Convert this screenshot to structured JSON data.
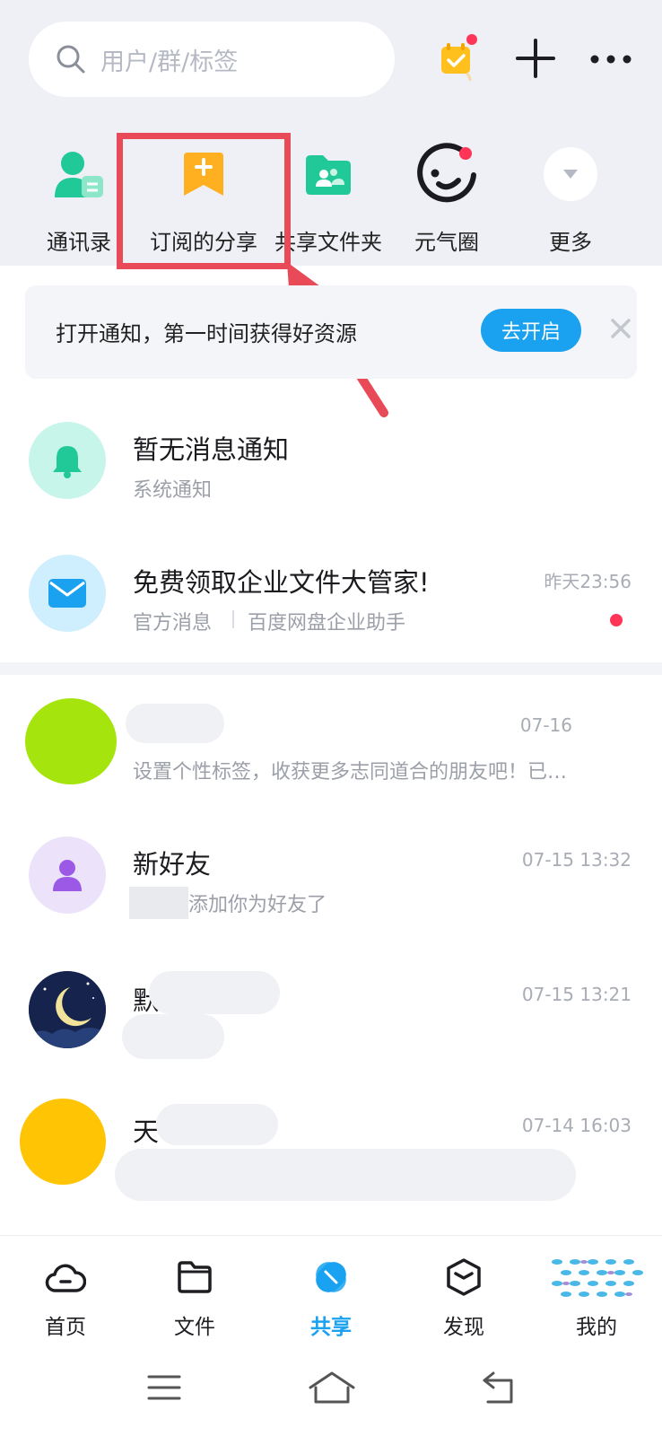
{
  "search": {
    "placeholder": "用户/群/标签"
  },
  "shortcuts": [
    {
      "label": "通讯录",
      "icon": "contacts-icon"
    },
    {
      "label": "订阅的分享",
      "icon": "bookmark-icon"
    },
    {
      "label": "共享文件夹",
      "icon": "shared-folder-icon"
    },
    {
      "label": "元气圈",
      "icon": "smile-circle-icon"
    },
    {
      "label": "更多",
      "icon": "chevron-down-icon"
    }
  ],
  "notice": {
    "text": "打开通知，第一时间获得好资源",
    "button": "去开启"
  },
  "messages": [
    {
      "title": "暂无消息通知",
      "sub": "系统通知",
      "time": ""
    },
    {
      "title": "免费领取企业文件大管家!",
      "sub_left": "官方消息",
      "sub_right": "百度网盘企业助手",
      "time": "昨天23:56"
    },
    {
      "title": "",
      "sub": "设置个性标签，收获更多志同道合的朋友吧！已…",
      "time": "07-16"
    },
    {
      "title": "新好友",
      "sub": "添加你为好友了",
      "time": "07-15 13:32"
    },
    {
      "title": "默",
      "sub": "",
      "time": "07-15 13:21"
    },
    {
      "title": "天",
      "sub": "",
      "time": "07-14 16:03"
    }
  ],
  "tabs": [
    {
      "label": "首页",
      "icon": "cloud-icon"
    },
    {
      "label": "文件",
      "icon": "folder-icon"
    },
    {
      "label": "共享",
      "icon": "share-icon"
    },
    {
      "label": "发现",
      "icon": "cube-icon"
    },
    {
      "label": "我的",
      "icon": "avatar-icon"
    }
  ],
  "colors": {
    "accent": "#1aa2f1",
    "highlight": "#e84a57",
    "badge": "#ff3557",
    "background_top": "#eef0f6"
  }
}
